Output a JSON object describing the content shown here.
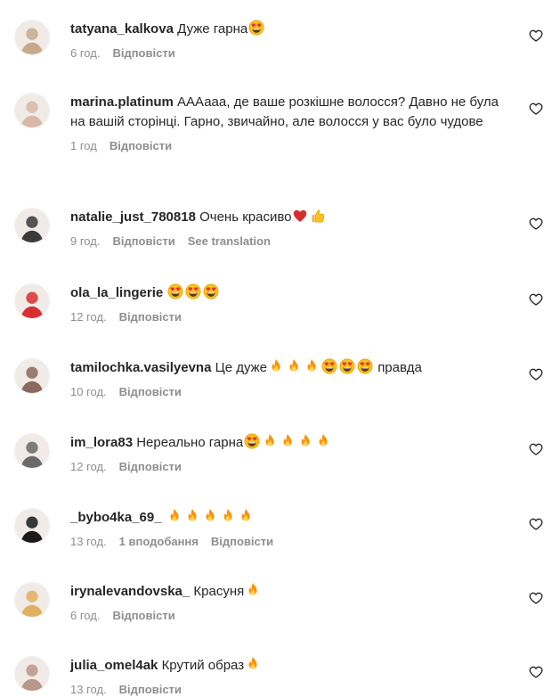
{
  "comments": [
    {
      "username": "tatyana_kalkova",
      "text": "Дуже гарна",
      "emojis": [
        "heart-eyes"
      ],
      "time": "6 год.",
      "reply": "Відповісти",
      "avatar_color": "#c9a88c"
    },
    {
      "username": "marina.platinum",
      "text": "АААааа, де ваше розкішне волосся? Давно не була на вашій сторінці. Гарно, звичайно, але волосся у вас було чудове",
      "emojis": [],
      "time": "1 год",
      "reply": "Відповісти",
      "avatar_color": "#d8b8a8"
    },
    {
      "username": "natalie_just_780818",
      "text": "Очень красиво",
      "emojis": [
        "red-heart",
        "thumbs-up"
      ],
      "time": "9 год.",
      "reply": "Відповісти",
      "translate": "See translation",
      "avatar_color": "#3a3a3a"
    },
    {
      "username": "ola_la_lingerie",
      "text": "",
      "emojis": [
        "heart-eyes",
        "heart-eyes",
        "heart-eyes"
      ],
      "time": "12 год.",
      "reply": "Відповісти",
      "avatar_color": "#d83030"
    },
    {
      "username": "tamilochka.vasilyevna",
      "text": "Це дуже",
      "emojis": [
        "fire",
        "fire",
        "fire",
        "heart-eyes",
        "heart-eyes",
        "heart-eyes"
      ],
      "text_after": "правда",
      "time": "10 год.",
      "reply": "Відповісти",
      "avatar_color": "#8a6a5a"
    },
    {
      "username": "im_lora83",
      "text": "Нереально гарна",
      "emojis": [
        "heart-eyes",
        "fire",
        "fire",
        "fire",
        "fire"
      ],
      "time": "12 год.",
      "reply": "Відповісти",
      "avatar_color": "#6a6a6a"
    },
    {
      "username": "_bybo4ka_69_",
      "text": "",
      "emojis": [
        "fire",
        "fire",
        "fire",
        "fire",
        "fire"
      ],
      "time": "13 год.",
      "likes": "1 вподобання",
      "reply": "Відповісти",
      "avatar_color": "#1a1a1a"
    },
    {
      "username": "irynalevandovska_",
      "text": "Красуня",
      "emojis": [
        "fire"
      ],
      "time": "6 год.",
      "reply": "Відповісти",
      "avatar_color": "#e0b060"
    },
    {
      "username": "julia_omel4ak",
      "text": "Крутий образ",
      "emojis": [
        "fire"
      ],
      "time": "13 год.",
      "reply": "Відповісти",
      "avatar_color": "#b89888"
    }
  ],
  "colors": {
    "text": "#262626",
    "meta": "#8e8e8e",
    "background": "#ffffff"
  },
  "icons": {
    "like": "heart-outline-icon"
  }
}
